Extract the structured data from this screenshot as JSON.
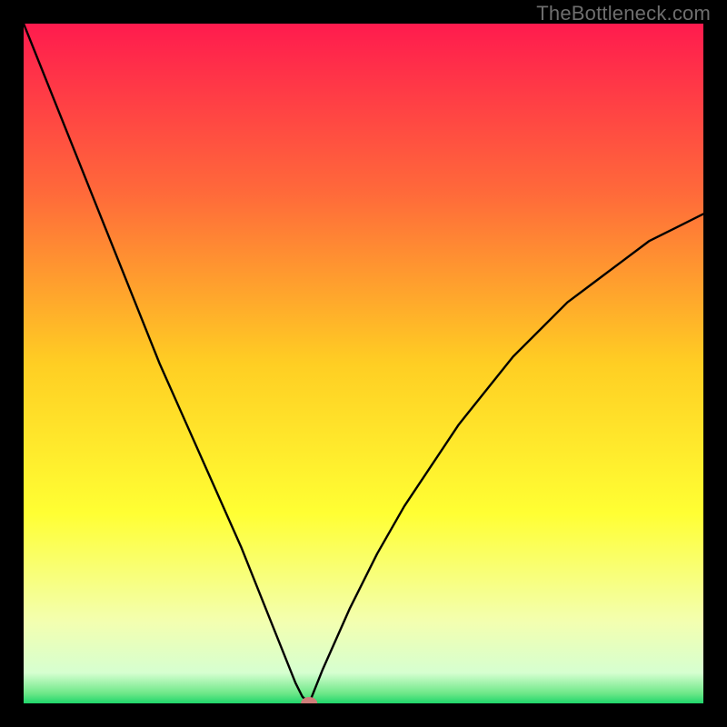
{
  "watermark": {
    "text": "TheBottleneck.com"
  },
  "chart_data": {
    "type": "line",
    "title": "",
    "xlabel": "",
    "ylabel": "",
    "xlim": [
      0,
      100
    ],
    "ylim": [
      0,
      100
    ],
    "grid": false,
    "legend": {
      "shown": false
    },
    "series": [
      {
        "name": "curve",
        "x": [
          0,
          4,
          8,
          12,
          16,
          20,
          24,
          28,
          32,
          36,
          38,
          40,
          41,
          42,
          44,
          48,
          52,
          56,
          60,
          64,
          68,
          72,
          76,
          80,
          84,
          88,
          92,
          96,
          100
        ],
        "values": [
          100,
          90,
          80,
          70,
          60,
          50,
          41,
          32,
          23,
          13,
          8,
          3,
          1,
          0,
          5,
          14,
          22,
          29,
          35,
          41,
          46,
          51,
          55,
          59,
          62,
          65,
          68,
          70,
          72
        ]
      }
    ],
    "marker": {
      "x": 42,
      "y": 0,
      "color": "#cf7e7a"
    },
    "background_gradient": {
      "stops": [
        {
          "offset": 0.0,
          "color": "#ff1b4e"
        },
        {
          "offset": 0.25,
          "color": "#ff6a3a"
        },
        {
          "offset": 0.5,
          "color": "#ffce23"
        },
        {
          "offset": 0.72,
          "color": "#ffff33"
        },
        {
          "offset": 0.88,
          "color": "#f3ffb0"
        },
        {
          "offset": 0.955,
          "color": "#d6ffd0"
        },
        {
          "offset": 0.985,
          "color": "#6fe889"
        },
        {
          "offset": 1.0,
          "color": "#1fd66b"
        }
      ]
    }
  }
}
